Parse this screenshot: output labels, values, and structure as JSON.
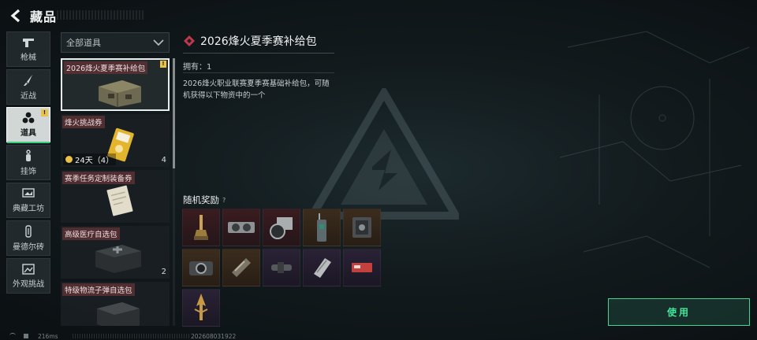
{
  "header": {
    "title": "藏品"
  },
  "nav": {
    "items": [
      {
        "label": "枪械",
        "icon": "pistol-icon"
      },
      {
        "label": "近战",
        "icon": "knife-icon"
      },
      {
        "label": "道具",
        "icon": "items-icon",
        "active": true,
        "badge": "!"
      },
      {
        "label": "挂饰",
        "icon": "charm-icon"
      },
      {
        "label": "典藏工坊",
        "icon": "workshop-icon"
      },
      {
        "label": "曼德尔砖",
        "icon": "brick-icon"
      },
      {
        "label": "外观挑战",
        "icon": "appearance-icon"
      }
    ]
  },
  "filter": {
    "value": "全部道具"
  },
  "item_list": [
    {
      "name": "2026烽火夏季赛补给包",
      "badge": "!",
      "selected": true
    },
    {
      "name": "烽火挑战券",
      "count": "4",
      "timer": "24天（4）"
    },
    {
      "name": "赛季任务定制装备券"
    },
    {
      "name": "高级医疗自选包",
      "count": "2"
    },
    {
      "name": "特级物流子弹自选包"
    }
  ],
  "detail": {
    "title": "2026烽火夏季赛补给包",
    "owned": "拥有：1",
    "description": "2026烽火职业联赛夏季赛基础补给包，可随机获得以下物资中的一个",
    "rewards_title": "随机奖励",
    "help_icon": "?",
    "rewards": [
      {
        "icon": "trophy-icon",
        "rarity": "red"
      },
      {
        "icon": "gpu-icon",
        "rarity": "red"
      },
      {
        "icon": "camera-icon",
        "rarity": "red"
      },
      {
        "icon": "radio-icon",
        "rarity": "gold"
      },
      {
        "icon": "safe-icon",
        "rarity": "gold"
      },
      {
        "icon": "compact-camera-icon",
        "rarity": "gold"
      },
      {
        "icon": "ammo-box-icon",
        "rarity": "gold"
      },
      {
        "icon": "scope-icon",
        "rarity": "purple"
      },
      {
        "icon": "hard-drive-icon",
        "rarity": "purple"
      },
      {
        "icon": "card-icon",
        "rarity": "purple"
      },
      {
        "icon": "arrowhead-icon",
        "rarity": "purple"
      }
    ]
  },
  "actions": {
    "use_label": "使用"
  },
  "footer": {
    "ping": "216ms",
    "uid": "202608031922"
  },
  "colors": {
    "accent": "#3fd890",
    "badge": "#e9c24a",
    "red_rarity": "#3a1c1f",
    "gold_rarity": "#3b2c1d",
    "purple_rarity": "#2a2236"
  }
}
